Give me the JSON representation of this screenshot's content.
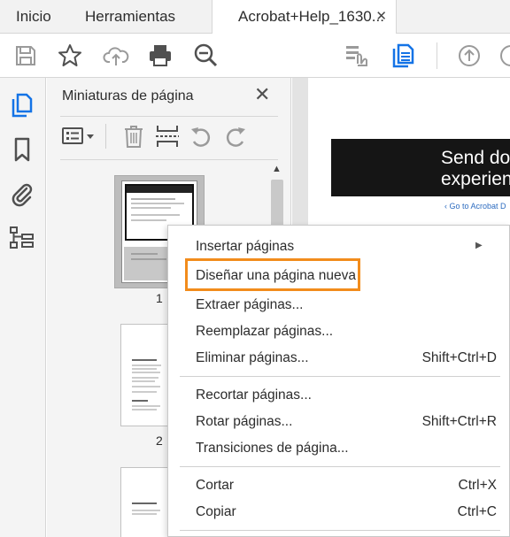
{
  "tabs": {
    "home": "Inicio",
    "tools": "Herramientas",
    "document": "Acrobat+Help_1630...",
    "close_glyph": "✕"
  },
  "toolbar": {
    "icons": [
      "save-icon",
      "star-icon",
      "upload-cloud-icon",
      "print-icon",
      "zoom-out-icon",
      "touch-mode-icon",
      "page-thumbnails-icon",
      "previous-page-icon",
      "next-page-icon"
    ]
  },
  "rail": {
    "icons": [
      "page-thumbnails-icon",
      "bookmark-icon",
      "attachment-icon",
      "structure-icon"
    ]
  },
  "panel": {
    "title": "Miniaturas de página",
    "close_glyph": "✕",
    "tool_icons": [
      "options-menu-icon",
      "delete-icon",
      "insert-pages-icon",
      "rotate-left-icon",
      "rotate-right-icon"
    ],
    "page_numbers": [
      "1",
      "2"
    ]
  },
  "document": {
    "banner_text_line1": "Send do",
    "banner_text_line2": "experien",
    "link_text": "‹ Go to Acrobat D"
  },
  "context_menu": {
    "items": [
      {
        "label": "Insertar páginas",
        "shortcut": "",
        "submenu": true
      },
      {
        "label": "Diseñar una página nueva",
        "shortcut": "",
        "highlighted": true
      },
      {
        "label": "Extraer páginas...",
        "shortcut": ""
      },
      {
        "label": "Reemplazar páginas...",
        "shortcut": ""
      },
      {
        "label": "Eliminar páginas...",
        "shortcut": "Shift+Ctrl+D"
      },
      {
        "label": "Recortar páginas...",
        "shortcut": ""
      },
      {
        "label": "Rotar páginas...",
        "shortcut": "Shift+Ctrl+R"
      },
      {
        "label": "Transiciones de página...",
        "shortcut": ""
      },
      {
        "label": "Cortar",
        "shortcut": "Ctrl+X"
      },
      {
        "label": "Copiar",
        "shortcut": "Ctrl+C"
      }
    ]
  },
  "colors": {
    "accent_blue": "#1473e6",
    "highlight_orange": "#f28c1c",
    "icon_gray": "#505050"
  }
}
